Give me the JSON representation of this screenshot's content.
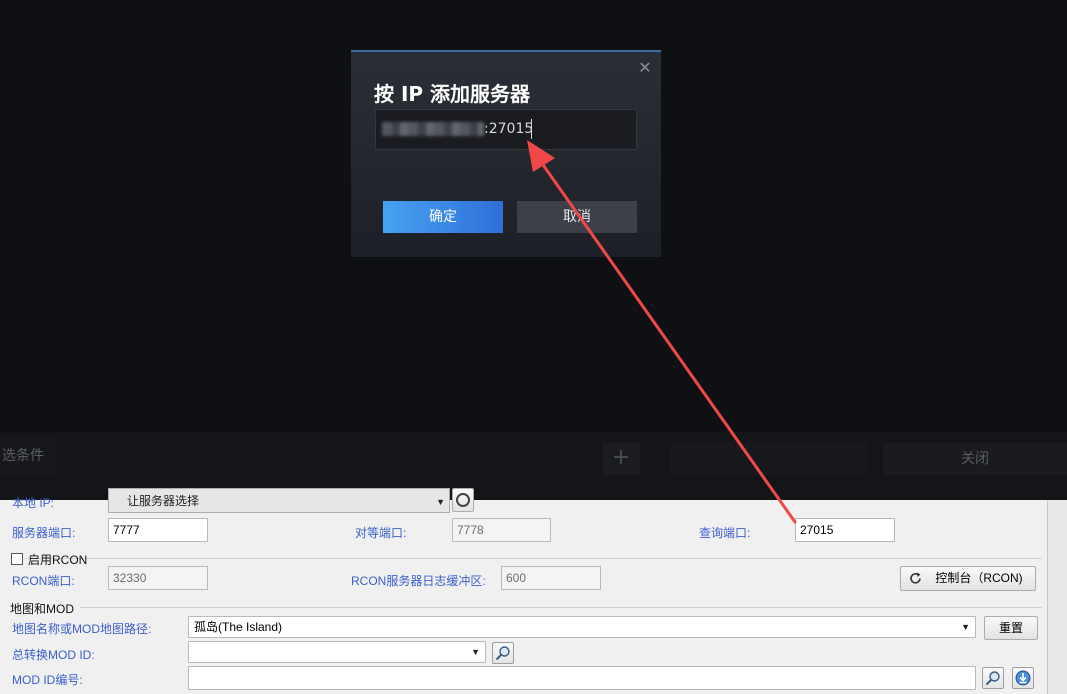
{
  "steam": {
    "filter_label": "选条件",
    "add_symbol": "+",
    "close_label": "关闭"
  },
  "dialog": {
    "title": "按 IP 添加服务器",
    "close_symbol": "✕",
    "ip_value": ":27015",
    "confirm_label": "确定",
    "cancel_label": "取消"
  },
  "app": {
    "local_ip_label": "本地 IP:",
    "local_ip_value": "让服务器选择",
    "server_port_label": "服务器端口:",
    "server_port_value": "7777",
    "peer_port_label": "对等端口:",
    "peer_port_value": "7778",
    "query_port_label": "查询端口:",
    "query_port_value": "27015",
    "enable_rcon_label": "启用RCON",
    "rcon_port_label": "RCON端口:",
    "rcon_port_value": "32330",
    "rcon_log_label": "RCON服务器日志缓冲区:",
    "rcon_log_value": "600",
    "console_button_label": "控制台（RCON)",
    "map_mod_group_label": "地图和MOD",
    "map_name_label": "地图名称或MOD地图路径:",
    "map_name_value": "孤岛(The Island)",
    "reset_button_label": "重置",
    "total_conversion_label": "总转换MOD ID:",
    "total_conversion_value": "",
    "mod_id_label": "MOD ID编号:",
    "mod_id_value": ""
  },
  "colors": {
    "annotation_arrow": "#f04848",
    "label_blue": "#3a5fcd",
    "confirm_blue": "#3b86e6"
  }
}
